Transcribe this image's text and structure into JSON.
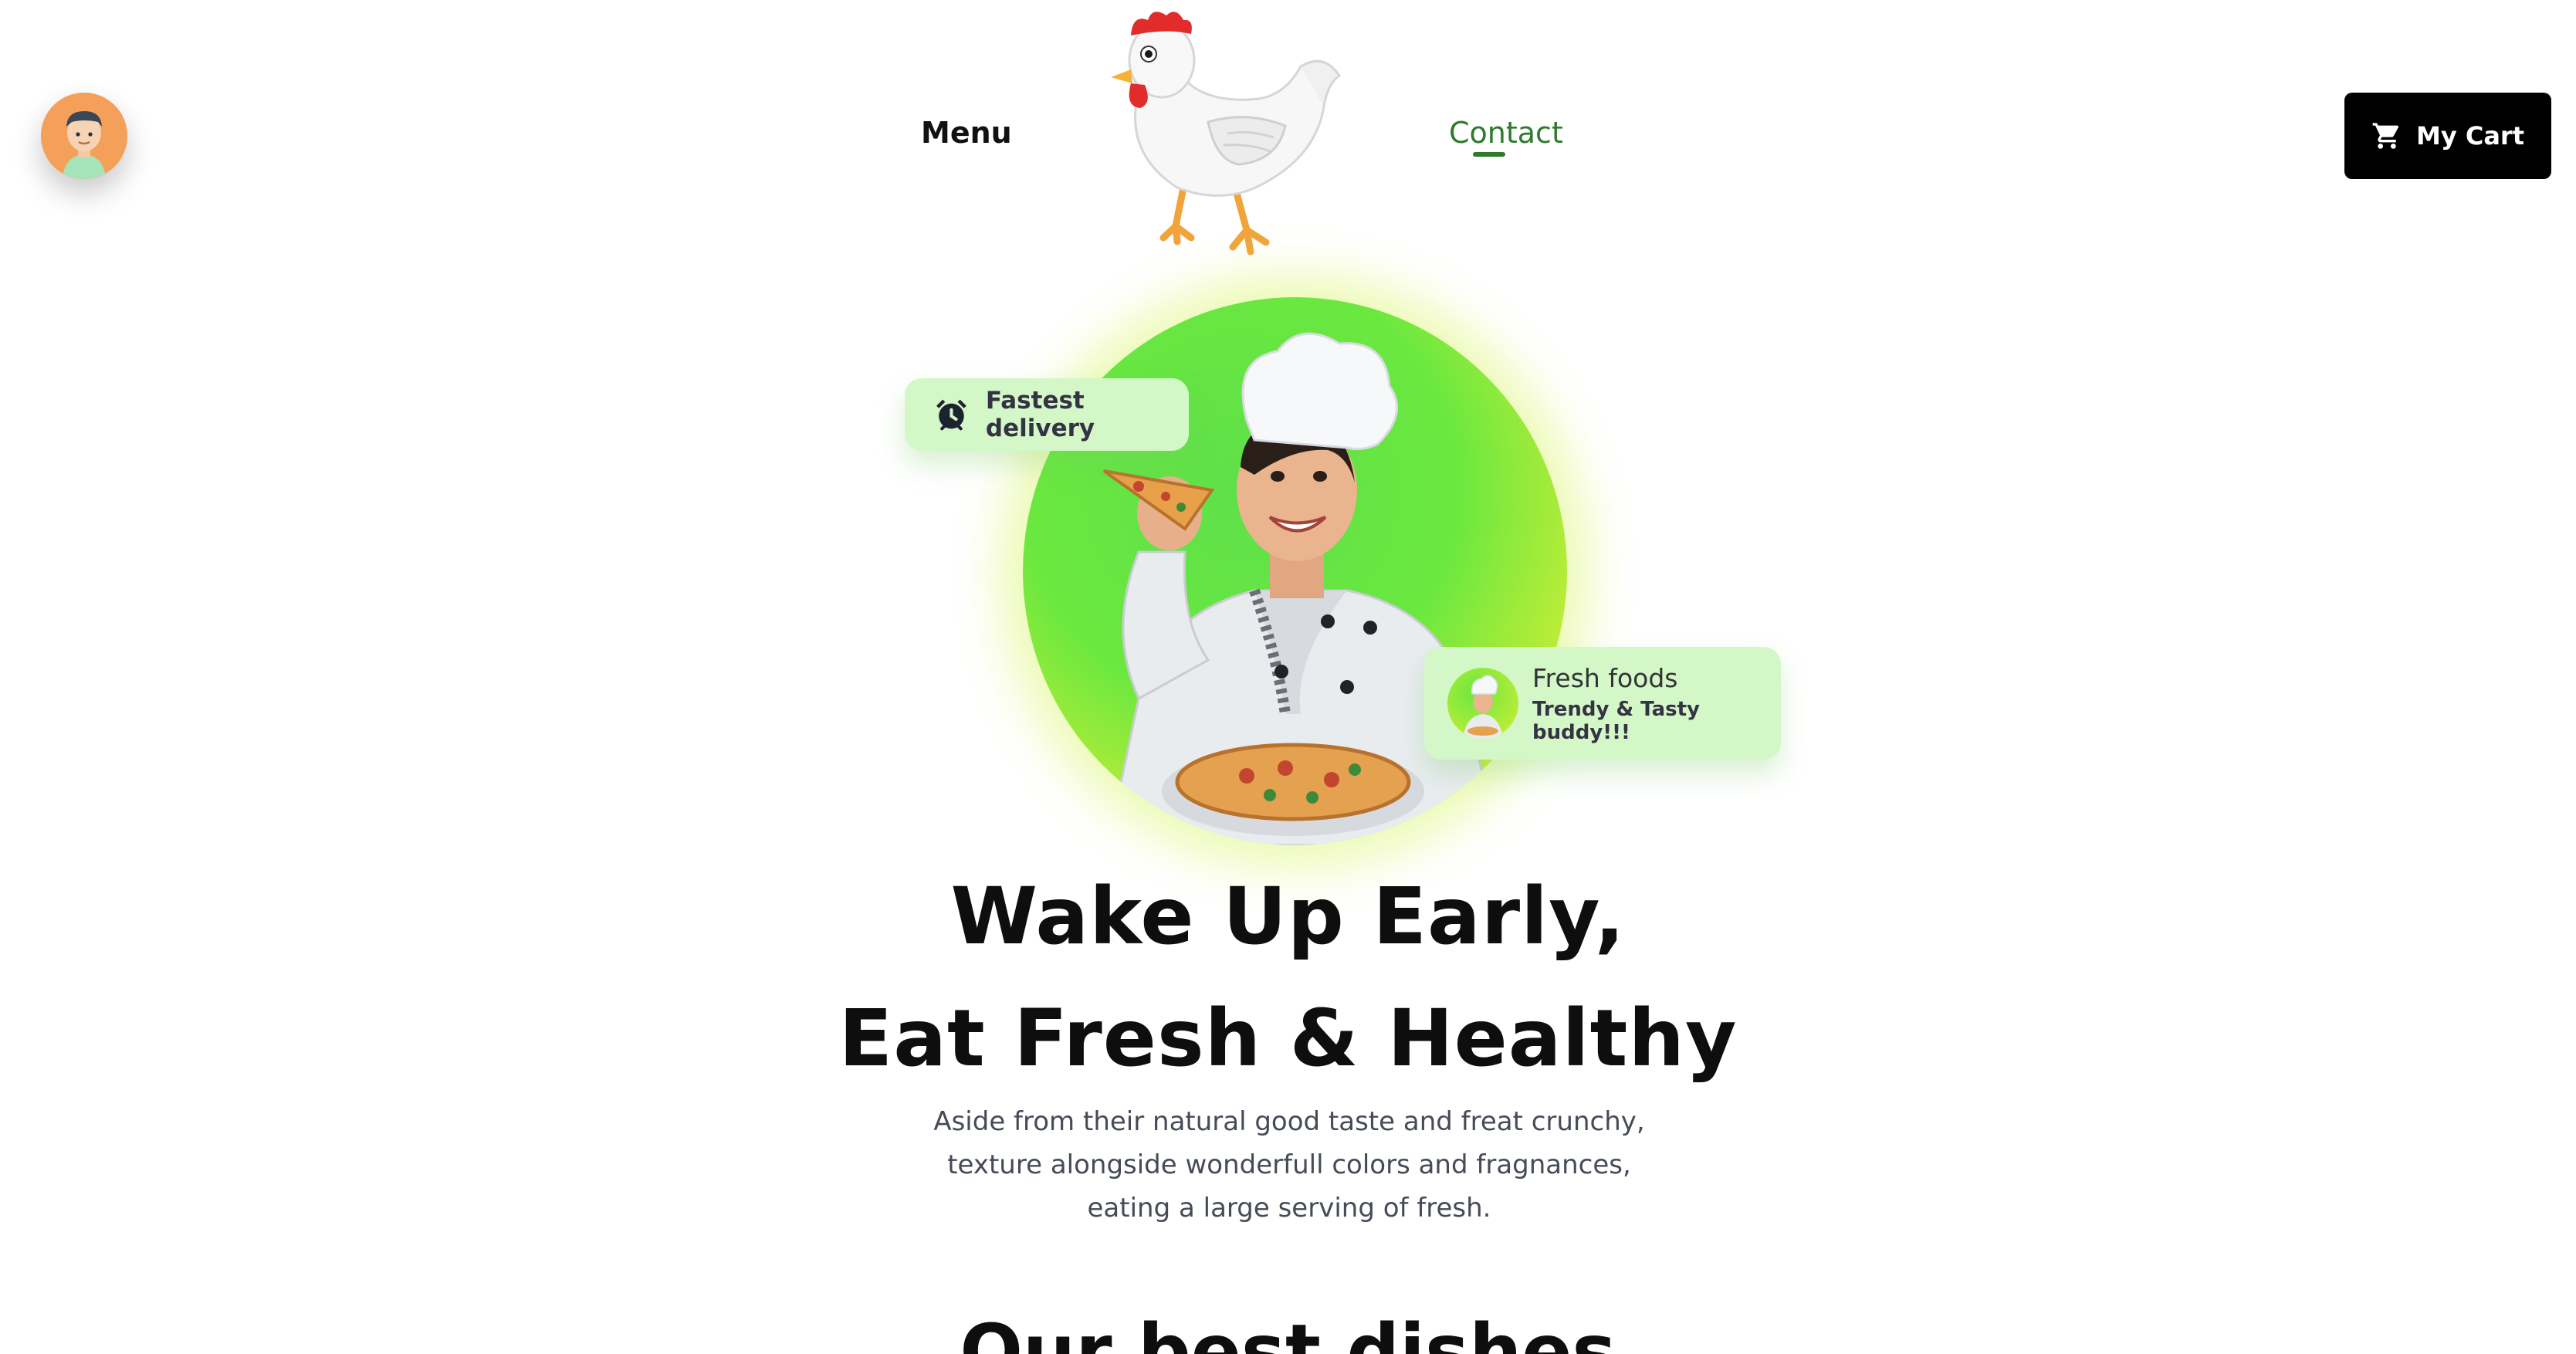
{
  "header": {
    "nav": {
      "menu_label": "Menu",
      "contact_label": "Contact"
    },
    "cart": {
      "label": "My Cart",
      "icon": "cart-icon"
    },
    "avatar_icon": "avatar"
  },
  "hero": {
    "badges": {
      "delivery": {
        "icon": "alarm-clock-icon",
        "label": "Fastest delivery"
      },
      "fresh": {
        "title": "Fresh foods",
        "subtitle": "Trendy & Tasty buddy!!!"
      }
    },
    "headline_line1": "Wake Up Early,",
    "headline_line2": "Eat Fresh & Healthy",
    "lead": "Aside from their natural good taste and freat crunchy, texture alongside wonderfull colors and fragnances, eating a large serving of fresh."
  },
  "next_section": {
    "title": "Our best dishes"
  },
  "colors": {
    "accent_green": "#2f7a2c",
    "badge_bg": "#d4f7c8",
    "cart_bg": "#000000",
    "avatar_bg": "#f4a05a"
  }
}
